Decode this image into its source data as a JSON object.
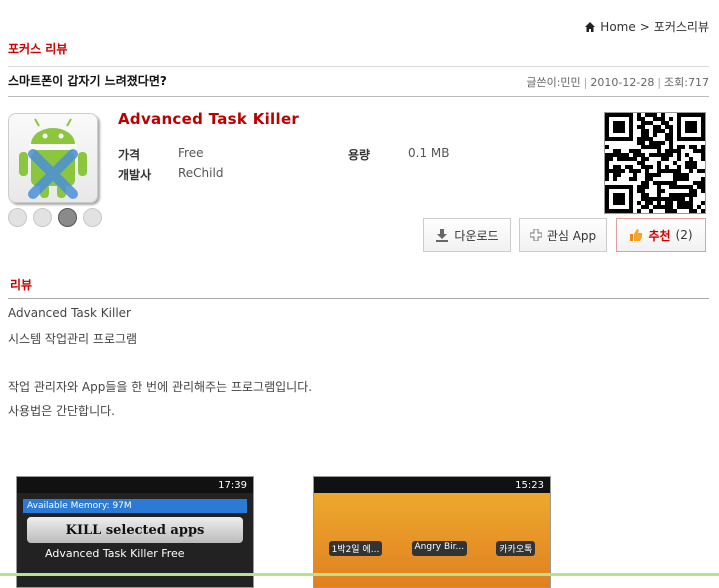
{
  "breadcrumb": {
    "home_label": "Home",
    "separator": ">",
    "current": "포커스리뷰"
  },
  "section": {
    "title": "포커스 리뷰"
  },
  "post": {
    "title": "스마트폰이 갑자기 느려졌다면?",
    "author_label": "글쓴이:민민",
    "date": "2010-12-28",
    "views_label": "조회:717"
  },
  "app": {
    "name": "Advanced Task Killer",
    "price_label": "가격",
    "price_value": "Free",
    "size_label": "용량",
    "size_value": "0.1 MB",
    "developer_label": "개발사",
    "developer_value": "ReChild",
    "platforms": [
      "apple-icon",
      "blackberry-icon",
      "android-icon",
      "windows-icon"
    ],
    "active_platform": "android"
  },
  "buttons": {
    "download_label": "다운로드",
    "interest_label": "관심 App",
    "recommend_label": "추천",
    "recommend_count": "(2)"
  },
  "review": {
    "header": "리뷰",
    "lines": [
      "Advanced Task Killer",
      "시스템 작업관리 프로그램",
      "작업 관리자와 App들을 한 번에 관리해주는 프로그램입니다.",
      "사용법은 간단합니다."
    ]
  },
  "screenshots": [
    {
      "time": "17:39",
      "memory_label": "Available Memory: 97M",
      "kill_button": "KILL selected apps",
      "app_row": "Advanced Task Killer Free"
    },
    {
      "time": "15:23",
      "app_labels": [
        "1박2일 에...",
        "Angry Bir...",
        "카카오톡"
      ]
    }
  ],
  "colors": {
    "accent": "#cc0000",
    "divider": "#d8d8d8"
  }
}
